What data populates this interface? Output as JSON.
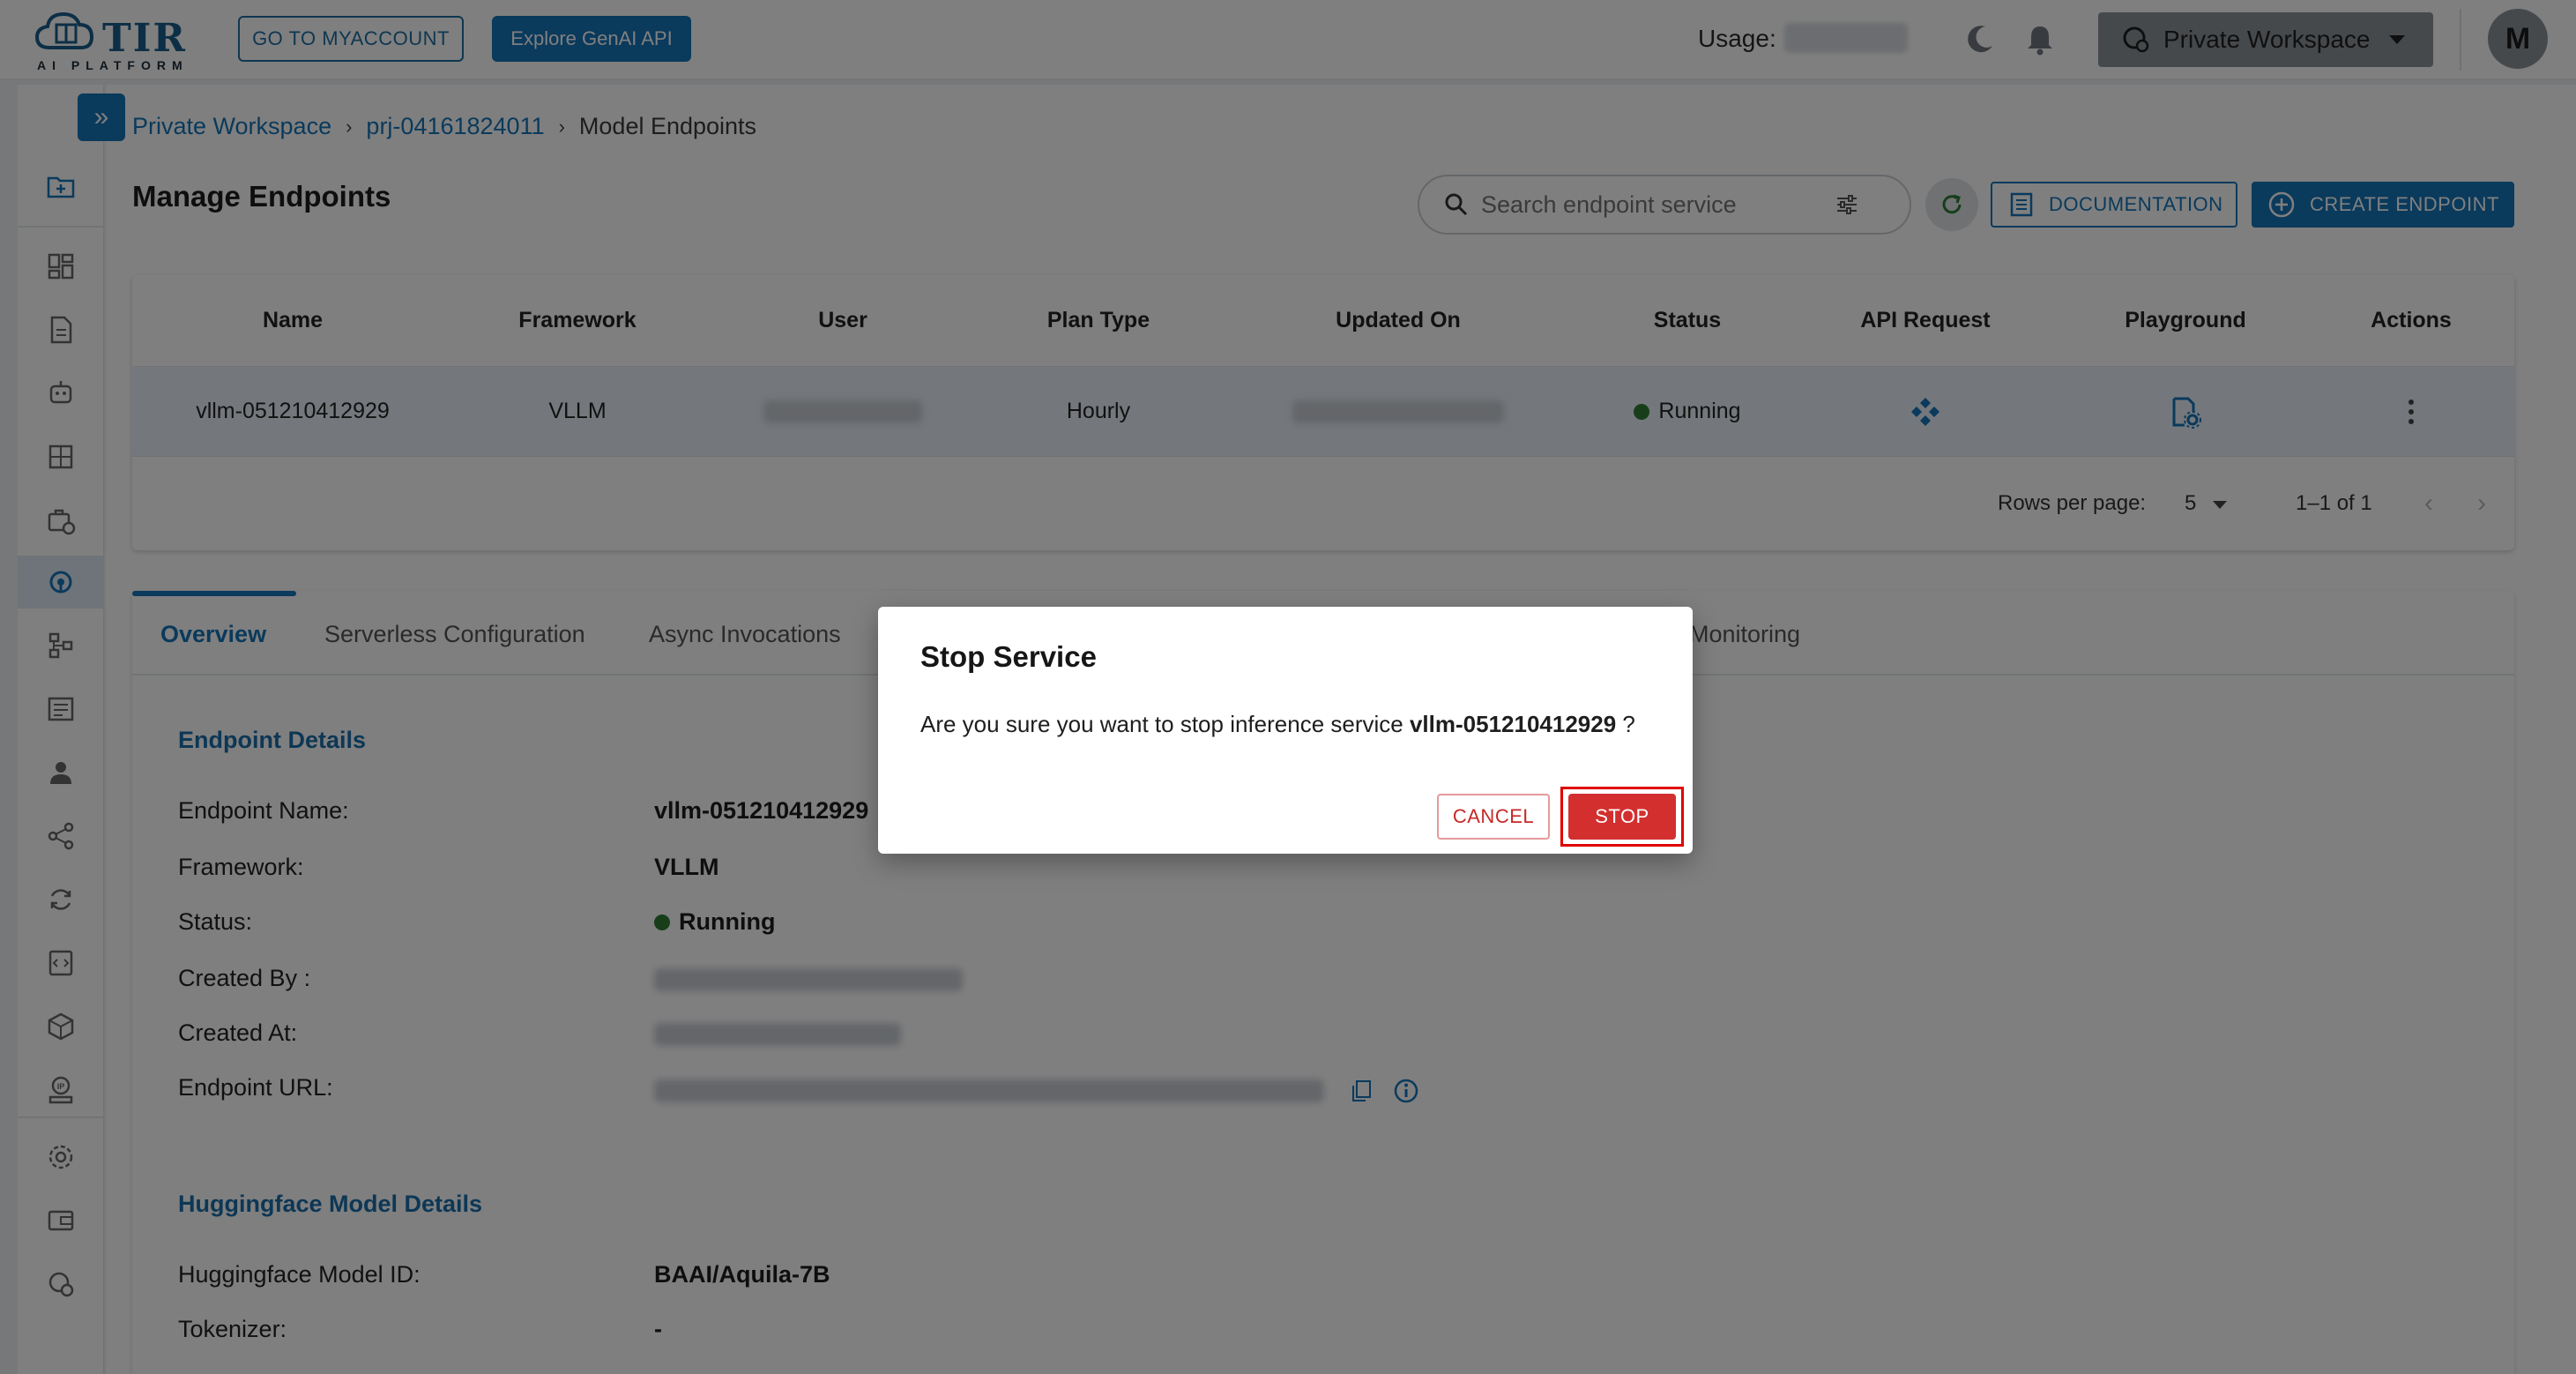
{
  "topbar": {
    "logo_text": "TIR",
    "logo_sub": "AI PLATFORM",
    "myaccount_label": "GO TO MYACCOUNT",
    "genai_label": "Explore GenAI API",
    "usage_label": "Usage:",
    "workspace_label": "Private Workspace",
    "avatar_initial": "M"
  },
  "nav": {
    "icons": [
      "folder-add-icon",
      "dashboard-icon",
      "notebook-icon",
      "robot-icon",
      "grid-icon",
      "jobs-icon",
      "model-endpoints-icon",
      "pipeline-icon",
      "dataset-icon",
      "user-icon",
      "share-icon",
      "sync-icon",
      "code-icon",
      "package-icon",
      "ip-icon",
      "settings-icon",
      "wallet-icon",
      "workspace-icon"
    ],
    "active": "model-endpoints-icon"
  },
  "breadcrumb": {
    "items": [
      "Private Workspace",
      "prj-04161824011",
      "Model Endpoints"
    ]
  },
  "page": {
    "title": "Manage Endpoints",
    "search_placeholder": "Search endpoint service",
    "documentation_label": "DOCUMENTATION",
    "create_label": "CREATE ENDPOINT"
  },
  "table": {
    "columns": [
      "Name",
      "Framework",
      "User",
      "Plan Type",
      "Updated On",
      "Status",
      "API Request",
      "Playground",
      "Actions"
    ],
    "rows": [
      {
        "name": "vllm-051210412929",
        "framework": "VLLM",
        "plan_type": "Hourly",
        "status": "Running"
      }
    ],
    "rows_per_page_label": "Rows per page:",
    "rows_per_page": "5",
    "page_range": "1–1 of 1"
  },
  "details": {
    "tabs": [
      "Overview",
      "Serverless Configuration",
      "Async Invocations",
      "Monitoring"
    ],
    "active_tab": "Overview",
    "endpoint_section": "Endpoint Details",
    "fields": {
      "name_label": "Endpoint Name:",
      "name_value": "vllm-051210412929",
      "framework_label": "Framework:",
      "framework_value": "VLLM",
      "status_label": "Status:",
      "status_value": "Running",
      "created_by_label": "Created By :",
      "created_at_label": "Created At:",
      "url_label": "Endpoint URL:"
    },
    "hf_section": "Huggingface Model Details",
    "hf_fields": {
      "model_id_label": "Huggingface Model ID:",
      "model_id_value": "BAAI/Aquila-7B",
      "tokenizer_label": "Tokenizer:",
      "tokenizer_value": "-"
    }
  },
  "modal": {
    "title": "Stop Service",
    "body_prefix": "Are you sure you want to stop inference service",
    "service_name": "vllm-051210412929",
    "body_suffix": "?",
    "cancel_label": "CANCEL",
    "stop_label": "STOP"
  },
  "colors": {
    "brand_blue": "#1474b8",
    "running_green": "#2e7d32",
    "danger_red": "#d32f2f"
  }
}
